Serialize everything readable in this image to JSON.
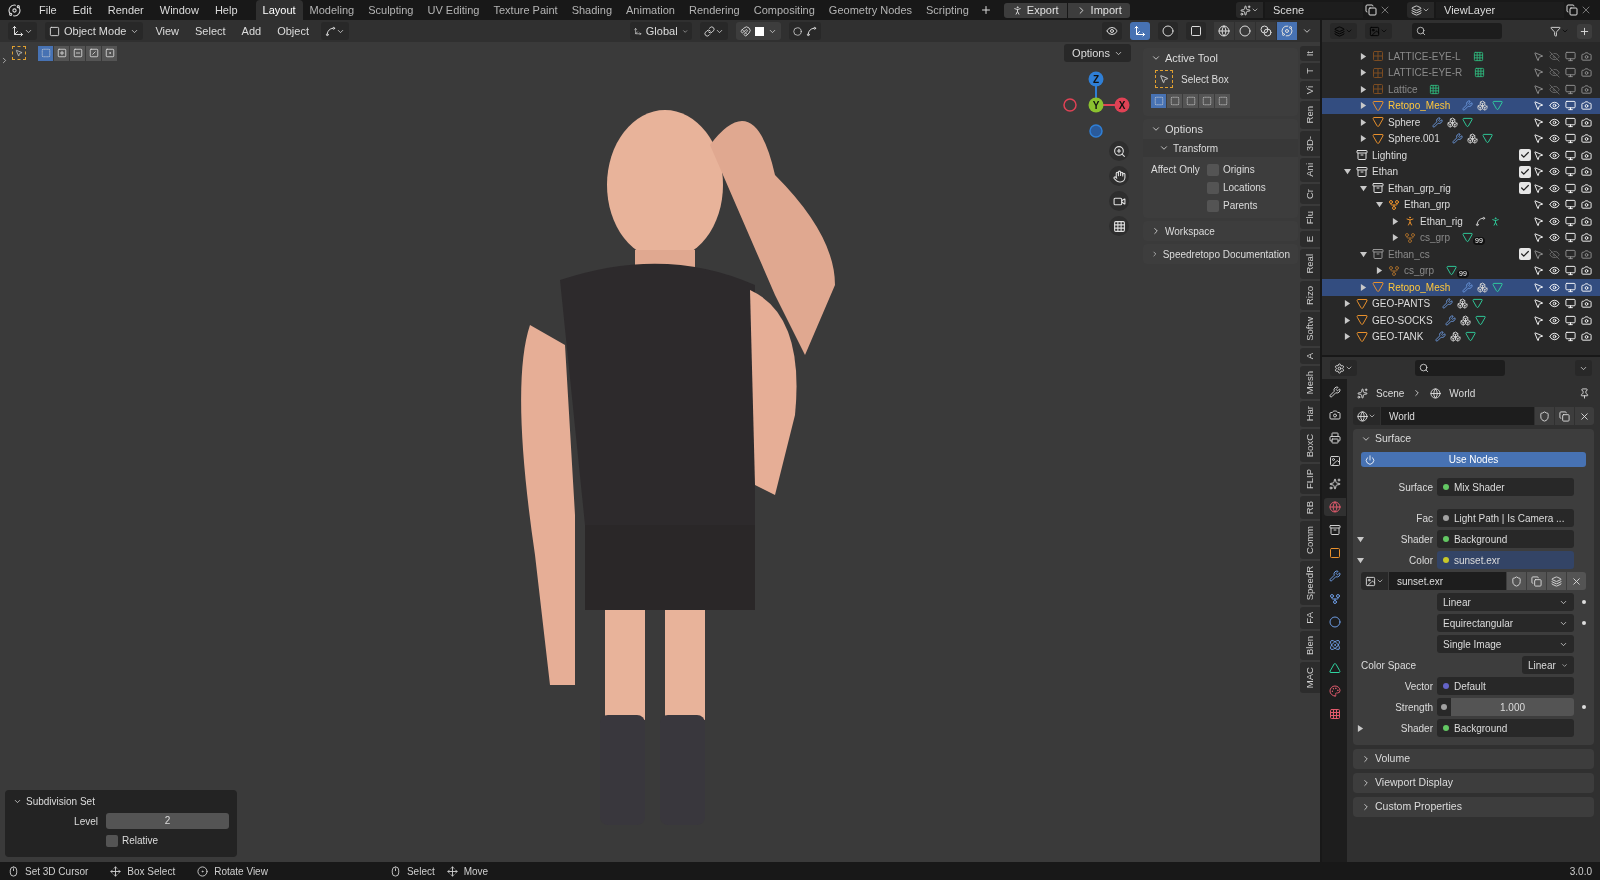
{
  "topbar": {
    "menus": [
      "File",
      "Edit",
      "Render",
      "Window",
      "Help"
    ],
    "workspaces": [
      {
        "label": "Layout",
        "selected": true
      },
      {
        "label": "Modeling",
        "selected": false
      },
      {
        "label": "Sculpting",
        "selected": false
      },
      {
        "label": "UV Editing",
        "selected": false
      },
      {
        "label": "Texture Paint",
        "selected": false
      },
      {
        "label": "Shading",
        "selected": false
      },
      {
        "label": "Animation",
        "selected": false
      },
      {
        "label": "Rendering",
        "selected": false
      },
      {
        "label": "Compositing",
        "selected": false
      },
      {
        "label": "Geometry Nodes",
        "selected": false
      },
      {
        "label": "Scripting",
        "selected": false
      }
    ],
    "addon_buttons": [
      "Export",
      "Import"
    ],
    "scene": "Scene",
    "view_layer": "ViewLayer"
  },
  "viewport_header": {
    "mode": "Object Mode",
    "menus": [
      "View",
      "Select",
      "Add",
      "Object"
    ],
    "orientation": "Global",
    "toggles": [
      {
        "kind": "visibility",
        "on": false
      },
      {
        "kind": "gizmo",
        "on": true
      },
      {
        "kind": "overlay",
        "on": false
      },
      {
        "kind": "xray",
        "on": false
      }
    ],
    "shading_modes": [
      {
        "kind": "wireframe",
        "selected": false
      },
      {
        "kind": "solid",
        "selected": false
      },
      {
        "kind": "material",
        "selected": false
      },
      {
        "kind": "rendered",
        "selected": true
      }
    ],
    "select_modes": [
      {
        "kind": "new",
        "selected": true
      },
      {
        "kind": "extend",
        "selected": false
      },
      {
        "kind": "subtract",
        "selected": false
      },
      {
        "kind": "invert",
        "selected": false
      },
      {
        "kind": "intersect",
        "selected": false
      }
    ],
    "options_button": "Options"
  },
  "gizmo": {
    "axes": [
      {
        "label": "Z",
        "color": "#2f7fd6"
      },
      {
        "label": "Y",
        "color": "#8bc22f"
      },
      {
        "label": "X",
        "color": "#e04255"
      }
    ]
  },
  "operator_panel": {
    "title": "Subdivision Set",
    "level_label": "Level",
    "level_value": "2",
    "relative": {
      "label": "Relative",
      "checked": false
    }
  },
  "sidebar": {
    "active_tool": {
      "title": "Active Tool",
      "tool": "Select Box",
      "modes": [
        {
          "selected": true
        },
        {
          "selected": false
        },
        {
          "selected": false
        },
        {
          "selected": false
        },
        {
          "selected": false
        }
      ]
    },
    "options": {
      "title": "Options",
      "subsection": "Transform",
      "affect_only": "Affect Only",
      "checkboxes": [
        {
          "label": "Origins",
          "checked": false
        },
        {
          "label": "Locations",
          "checked": false
        },
        {
          "label": "Parents",
          "checked": false
        }
      ]
    },
    "collapsed_panels": [
      "Workspace",
      "Speedretopo Documentation"
    ],
    "tabs": [
      "It",
      "T",
      "Vi",
      "Ren",
      "3D-",
      "Ani",
      "Cr",
      "Flu",
      "E",
      "Real",
      "Rizo",
      "Softw",
      "A",
      "Mesh",
      "Har",
      "BoxC",
      "FLIP",
      "RB",
      "Comm",
      "SpeedR",
      "FA",
      "Blen",
      "MAC"
    ]
  },
  "outliner": {
    "partial_group": [
      {
        "name": "LATTICE-EYE-L",
        "kind": "lattice",
        "expanded": false,
        "selected": false,
        "dimmed": true,
        "visible": false
      },
      {
        "name": "LATTICE-EYE-R",
        "kind": "lattice",
        "expanded": false,
        "selected": false,
        "dimmed": true,
        "visible": false
      },
      {
        "name": "Lattice",
        "kind": "lattice",
        "expanded": false,
        "selected": false,
        "dimmed": true,
        "visible": false
      },
      {
        "name": "Retopo_Mesh",
        "kind": "mesh",
        "expanded": false,
        "selected": true,
        "dimmed": false,
        "visible": true
      },
      {
        "name": "Sphere",
        "kind": "mesh",
        "expanded": false,
        "selected": false,
        "dimmed": false,
        "visible": true
      },
      {
        "name": "Sphere.001",
        "kind": "mesh",
        "expanded": false,
        "selected": false,
        "dimmed": false,
        "visible": true
      }
    ],
    "items": [
      {
        "name": "Lighting",
        "kind": "collection",
        "checked": true,
        "selected": false,
        "dimmed": false,
        "visible": true
      },
      {
        "name": "Ethan",
        "kind": "collection",
        "checked": true,
        "expanded": true,
        "selected": false,
        "dimmed": false,
        "visible": true,
        "children": [
          {
            "name": "Ethan_grp_rig",
            "kind": "collection",
            "checked": true,
            "expanded": true,
            "selected": false,
            "dimmed": false,
            "visible": true,
            "children": [
              {
                "name": "Ethan_grp",
                "kind": "empty",
                "expanded": true,
                "selected": false,
                "dimmed": false,
                "visible": true,
                "children": [
                  {
                    "name": "Ethan_rig",
                    "kind": "armature",
                    "expanded": false,
                    "selected": false,
                    "dimmed": false,
                    "visible": true
                  },
                  {
                    "name": "cs_grp",
                    "kind": "empty",
                    "badge": "99",
                    "expanded": false,
                    "selected": false,
                    "dimmed": true,
                    "visible": true
                  }
                ]
              }
            ]
          },
          {
            "name": "Ethan_cs",
            "kind": "collection",
            "checked": true,
            "expanded": true,
            "selected": false,
            "dimmed": true,
            "visible": false,
            "children": [
              {
                "name": "cs_grp",
                "kind": "empty",
                "badge": "99",
                "expanded": false,
                "selected": false,
                "dimmed": true,
                "visible": true
              }
            ]
          },
          {
            "name": "Retopo_Mesh",
            "kind": "mesh",
            "expanded": false,
            "selected": true,
            "dimmed": false,
            "visible": true
          }
        ]
      },
      {
        "name": "GEO-PANTS",
        "kind": "mesh",
        "expanded": false,
        "selected": false,
        "dimmed": false,
        "visible": true
      },
      {
        "name": "GEO-SOCKS",
        "kind": "mesh",
        "expanded": false,
        "selected": false,
        "dimmed": false,
        "visible": true
      },
      {
        "name": "GEO-TANK",
        "kind": "mesh",
        "expanded": false,
        "selected": false,
        "dimmed": false,
        "visible": true
      }
    ]
  },
  "properties": {
    "tabs": [
      {
        "kind": "tool",
        "selected": false
      },
      {
        "kind": "render",
        "selected": false
      },
      {
        "kind": "output",
        "selected": false
      },
      {
        "kind": "view_layer",
        "selected": false
      },
      {
        "kind": "scene",
        "selected": false
      },
      {
        "kind": "world",
        "selected": true
      },
      {
        "kind": "collection",
        "selected": false
      },
      {
        "kind": "object",
        "selected": false
      },
      {
        "kind": "modifier",
        "selected": false
      },
      {
        "kind": "particles",
        "selected": false
      },
      {
        "kind": "physics",
        "selected": false
      },
      {
        "kind": "constraints",
        "selected": false
      },
      {
        "kind": "data",
        "selected": false
      },
      {
        "kind": "material",
        "selected": false
      },
      {
        "kind": "texture",
        "selected": false
      }
    ],
    "breadcrumb": [
      "Scene",
      "World"
    ],
    "datablock": "World",
    "surface": {
      "title": "Surface",
      "use_nodes": "Use Nodes",
      "rows": [
        {
          "kind": "socket",
          "label": "Surface",
          "value": "Mix Shader",
          "color": "#63c763",
          "active": false
        },
        {
          "kind": "socket",
          "label": "Fac",
          "value": "Light Path | Is Camera ...",
          "color": "#a1a1a1",
          "active": false
        },
        {
          "kind": "socket",
          "label": "Shader",
          "value": "Background",
          "color": "#63c763",
          "expanded": true,
          "active": false
        },
        {
          "kind": "socket",
          "label": "Color",
          "value": "sunset.exr",
          "color": "#c7c729",
          "expanded": true,
          "active": true
        },
        {
          "kind": "image",
          "value": "sunset.exr"
        },
        {
          "kind": "dropdown",
          "value": "Linear",
          "dot": true
        },
        {
          "kind": "dropdown",
          "value": "Equirectangular",
          "dot": true
        },
        {
          "kind": "dropdown",
          "value": "Single Image",
          "dot": false
        },
        {
          "kind": "labeled_dropdown",
          "label": "Color Space",
          "value": "Linear"
        },
        {
          "kind": "socket",
          "label": "Vector",
          "value": "Default",
          "color": "#6363c7",
          "active": false
        },
        {
          "kind": "slider",
          "label": "Strength",
          "value": "1.000",
          "color": "#a1a1a1",
          "dot": true
        },
        {
          "kind": "socket",
          "label": "Shader",
          "value": "Background",
          "color": "#63c763",
          "expanded": false,
          "active": false
        }
      ]
    },
    "collapsed_panels": [
      "Volume",
      "Viewport Display",
      "Custom Properties"
    ]
  },
  "status_bar": {
    "hints": [
      {
        "kind": "left",
        "text": "Set 3D Cursor"
      },
      {
        "kind": "drag",
        "text": "Box Select"
      },
      {
        "kind": "middle",
        "text": "Rotate View"
      },
      {
        "kind": "left",
        "text": "Select"
      },
      {
        "kind": "drag",
        "text": "Move"
      }
    ],
    "version": "3.0.0"
  }
}
